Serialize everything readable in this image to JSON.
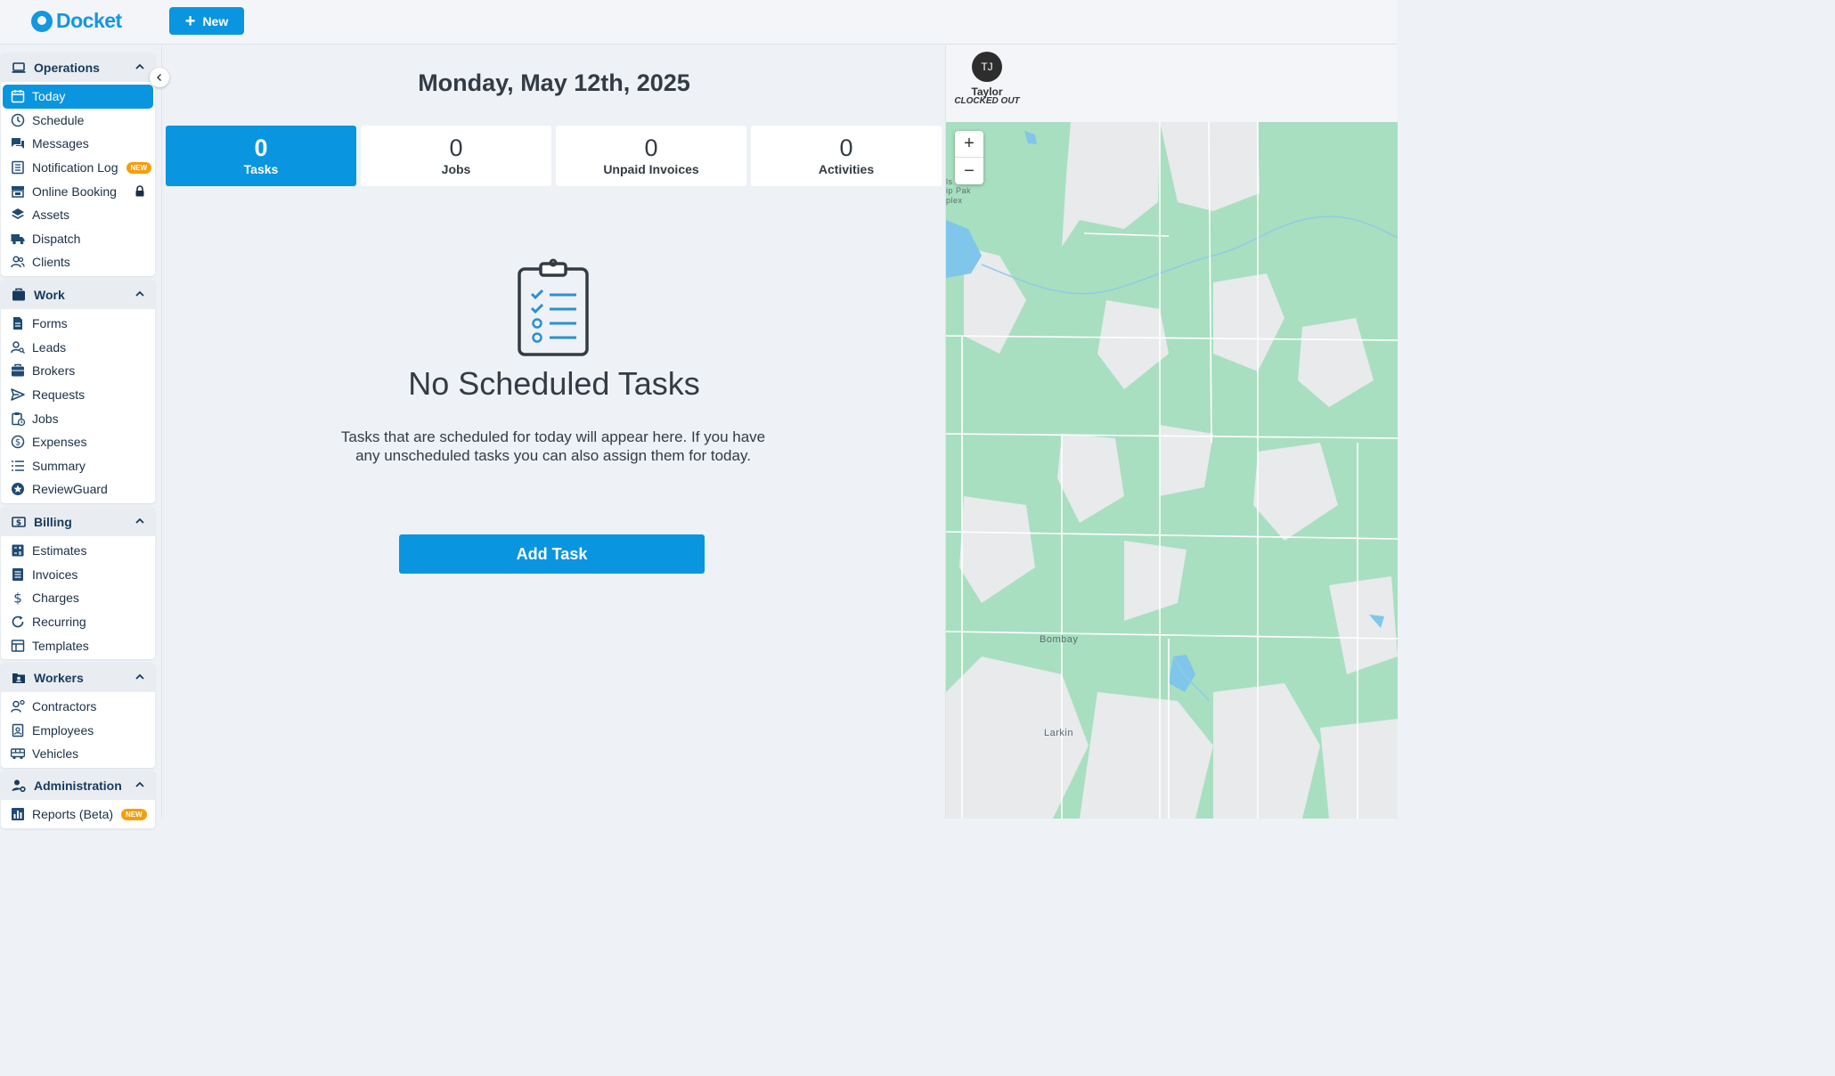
{
  "app": {
    "name": "Docket"
  },
  "toolbar": {
    "new_label": "New"
  },
  "sidebar": {
    "groups": [
      {
        "title": "Operations",
        "items": [
          {
            "label": "Today",
            "icon": "calendar-icon",
            "active": true
          },
          {
            "label": "Schedule",
            "icon": "clock-icon"
          },
          {
            "label": "Messages",
            "icon": "chat-icon"
          },
          {
            "label": "Notification Log",
            "icon": "list-icon",
            "badge": "NEW"
          },
          {
            "label": "Online Booking",
            "icon": "store-icon",
            "locked": true
          },
          {
            "label": "Assets",
            "icon": "layers-icon"
          },
          {
            "label": "Dispatch",
            "icon": "truck-icon"
          },
          {
            "label": "Clients",
            "icon": "users-icon"
          }
        ]
      },
      {
        "title": "Work",
        "items": [
          {
            "label": "Forms",
            "icon": "document-icon"
          },
          {
            "label": "Leads",
            "icon": "user-search-icon"
          },
          {
            "label": "Brokers",
            "icon": "briefcase-icon"
          },
          {
            "label": "Requests",
            "icon": "send-icon"
          },
          {
            "label": "Jobs",
            "icon": "clipboard-clock-icon"
          },
          {
            "label": "Expenses",
            "icon": "dollar-circle-icon"
          },
          {
            "label": "Summary",
            "icon": "list-bullets-icon"
          },
          {
            "label": "ReviewGuard",
            "icon": "star-badge-icon"
          }
        ]
      },
      {
        "title": "Billing",
        "items": [
          {
            "label": "Estimates",
            "icon": "calculator-icon"
          },
          {
            "label": "Invoices",
            "icon": "invoice-icon"
          },
          {
            "label": "Charges",
            "icon": "dollar-icon"
          },
          {
            "label": "Recurring",
            "icon": "refresh-icon"
          },
          {
            "label": "Templates",
            "icon": "template-icon"
          }
        ]
      },
      {
        "title": "Workers",
        "items": [
          {
            "label": "Contractors",
            "icon": "contractor-icon"
          },
          {
            "label": "Employees",
            "icon": "id-badge-icon"
          },
          {
            "label": "Vehicles",
            "icon": "bus-icon"
          }
        ]
      },
      {
        "title": "Administration",
        "items": [
          {
            "label": "Reports (Beta)",
            "icon": "bar-chart-icon",
            "badge": "NEW"
          }
        ]
      }
    ]
  },
  "main": {
    "date": "Monday, May 12th, 2025",
    "stats": [
      {
        "value": "0",
        "label": "Tasks",
        "active": true
      },
      {
        "value": "0",
        "label": "Jobs"
      },
      {
        "value": "0",
        "label": "Unpaid Invoices"
      },
      {
        "value": "0",
        "label": "Activities"
      }
    ],
    "empty_title": "No Scheduled Tasks",
    "empty_desc": "Tasks that are scheduled for today will appear here. If you have any unscheduled tasks you can also assign them for today.",
    "add_task_label": "Add Task"
  },
  "worker": {
    "initials": "TJ",
    "name": "Taylor",
    "status": "CLOCKED OUT"
  },
  "map": {
    "zoom_in": "+",
    "zoom_out": "−",
    "labels": {
      "bombay": "Bombay",
      "larkin": "Larkin",
      "edge1": "ls",
      "edge2": "ip Pak",
      "edge3": "plex"
    }
  },
  "colors": {
    "accent": "#0a95e0",
    "badge": "#f59e0b",
    "map_green": "#a8dfc0",
    "map_gray": "#e8eaec"
  }
}
